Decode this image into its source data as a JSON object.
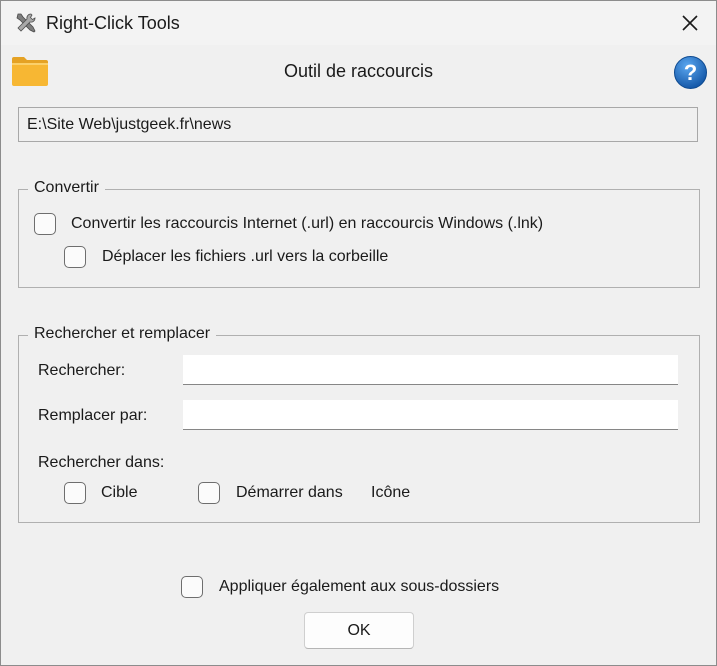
{
  "window": {
    "title": "Right-Click Tools",
    "title_icon": "tools-icon",
    "close_icon": "close-icon"
  },
  "header": {
    "title": "Outil de raccourcis",
    "folder_icon": "folder-icon",
    "help_icon": "help-icon",
    "help_glyph": "?"
  },
  "path": {
    "value": "E:\\Site Web\\justgeek.fr\\news"
  },
  "convert_group": {
    "legend": "Convertir",
    "convert_label": "Convertir les raccourcis Internet (.url) en raccourcis Windows (.lnk)",
    "convert_checked": false,
    "move_label": "Déplacer les fichiers .url vers la corbeille",
    "move_checked": false
  },
  "search_group": {
    "legend": "Rechercher et remplacer",
    "search_label": "Rechercher:",
    "search_value": "",
    "replace_label": "Remplacer par:",
    "replace_value": "",
    "search_in_label": "Rechercher dans:",
    "target_label": "Cible",
    "target_checked": false,
    "start_in_label": "Démarrer dans",
    "start_in_checked": false,
    "icon_label": "Icône"
  },
  "footer": {
    "subfolders_label": "Appliquer également aux sous-dossiers",
    "subfolders_checked": false,
    "ok_label": "OK"
  },
  "colors": {
    "window_bg": "#f0f0f0",
    "folder": "#f7b733",
    "help_blue": "#1e72c8"
  }
}
